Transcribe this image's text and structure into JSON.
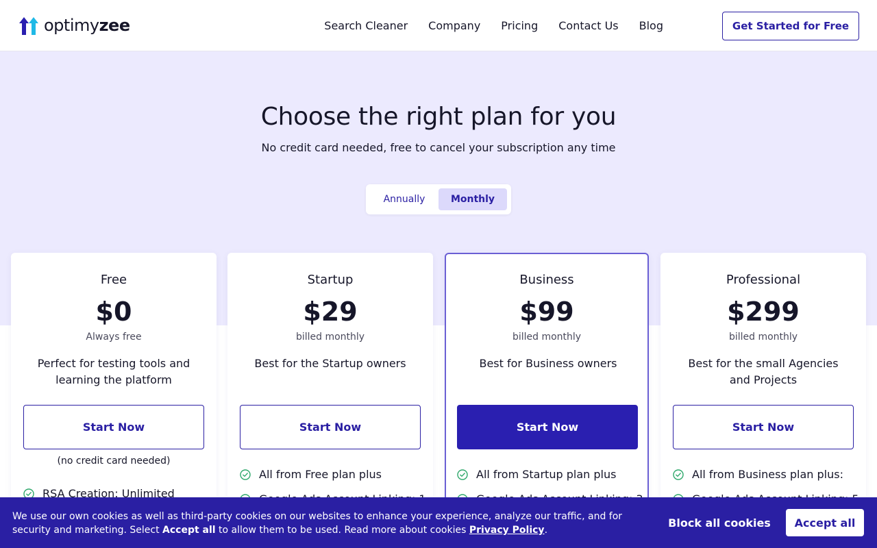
{
  "brand": {
    "name_part1": "optimy",
    "name_part2": "zee",
    "accent": "#2a1fa3"
  },
  "nav": {
    "items": [
      "Search Cleaner",
      "Company",
      "Pricing",
      "Contact Us",
      "Blog"
    ],
    "cta": "Get Started for Free"
  },
  "hero": {
    "title": "Choose the right plan for you",
    "subtitle": "No credit card needed, free to cancel your subscription any time"
  },
  "billing_toggle": {
    "annually": "Annually",
    "monthly": "Monthly",
    "selected": "Monthly"
  },
  "plans": [
    {
      "name": "Free",
      "price": "$0",
      "period": "Always free",
      "desc": "Perfect for testing tools and learning the platform",
      "button": "Start Now",
      "note": "(no credit card needed)",
      "features": [
        "RSA Creation: Unlimited"
      ]
    },
    {
      "name": "Startup",
      "price": "$29",
      "period": "billed monthly",
      "desc": "Best for the Startup owners",
      "button": "Start Now",
      "features": [
        "All from Free plan plus",
        "Google Ads Account Linking: 1"
      ]
    },
    {
      "name": "Business",
      "price": "$99",
      "period": "billed monthly",
      "desc": "Best for Business owners",
      "button": "Start Now",
      "features": [
        "All from Startup plan plus",
        "Google Ads Account Linking: 3"
      ]
    },
    {
      "name": "Professional",
      "price": "$299",
      "period": "billed monthly",
      "desc": "Best for the small Agencies and Projects",
      "button": "Start Now",
      "features": [
        "All from Business plan plus:",
        "Google Ads Account Linking: 5"
      ]
    }
  ],
  "cookie": {
    "text_part1": "We use our own cookies as well as third-party cookies on our websites to enhance your experience, analyze our traffic, and for security and marketing. Select ",
    "accept_inline": "Accept all",
    "text_part2": " to allow them to be used. Read more about cookies ",
    "privacy_link": "Privacy Policy",
    "text_part3": ".",
    "block_button": "Block all cookies",
    "accept_button": "Accept all"
  }
}
